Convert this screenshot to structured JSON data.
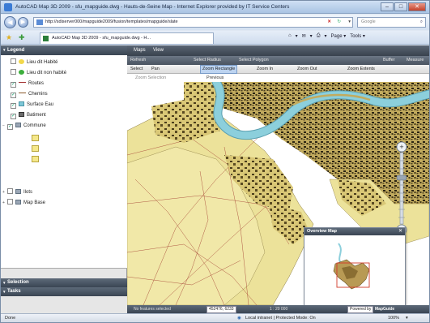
{
  "window": {
    "title": "AutoCAD Map 3D 2009 - sfu_mapguide.dwg - Hauts-de-Seine Map - Internet Explorer provided by IT Service Centers",
    "controls": {
      "minimize": "–",
      "maximize": "□",
      "close": "✕"
    }
  },
  "addressbar": {
    "url": "http://sdiserver000/mapguide2009/fusion/templates/mapguide/slate",
    "search_placeholder": "Google",
    "back": "◀",
    "forward": "▶",
    "stop": "✕",
    "refresh": "↻",
    "search_icon": "⌕"
  },
  "tabs": {
    "favorites_star": "★",
    "add_favorite": "✚",
    "active_tab": "AutoCAD Map 3D 2009 - sfu_mapguide.dwg - H...",
    "tools": [
      "⌂",
      "▾",
      "✉",
      "▾",
      "⎙",
      "▾",
      "Page ▾",
      "Tools ▾"
    ]
  },
  "legend": {
    "title": "Legend",
    "items": [
      {
        "label": "Lieu dit Habité",
        "swatch": "#f2d84b",
        "shape": "dot",
        "checked": false
      },
      {
        "label": "Lieu dit non habité",
        "swatch": "#3cae3c",
        "shape": "dot",
        "checked": false
      },
      {
        "label": "Routes",
        "swatch": "#a33333",
        "shape": "line",
        "checked": true
      },
      {
        "label": "Chemins",
        "swatch": "#8b5a2b",
        "shape": "line",
        "checked": true
      },
      {
        "label": "Surface Eau",
        "swatch": "#7fc8d8",
        "shape": "box",
        "checked": true
      },
      {
        "label": "Batiment",
        "swatch": "#6b6b6b",
        "shape": "box",
        "checked": true
      },
      {
        "label": "Commune",
        "swatch": "#f5e88a",
        "shape": "group",
        "checked": true
      },
      {
        "label": "Ilots",
        "swatch": "#9aa6b5",
        "shape": "group",
        "checked": false
      },
      {
        "label": "Map Base",
        "swatch": "#9aa6b5",
        "shape": "group",
        "checked": false
      }
    ],
    "expander": "+",
    "scroll_left": "◀",
    "scroll_right": "▶"
  },
  "panels": {
    "selection": "Selection",
    "tasks": "Tasks"
  },
  "map": {
    "menu": [
      "Maps",
      "View"
    ],
    "toolbar1": [
      "Refresh",
      "Select Radius",
      "Select Polygon",
      "Buffer",
      "Measure"
    ],
    "toolbar2": [
      "Select",
      "Pan",
      "Zoom Rectangle",
      "Zoom In",
      "Zoom Out",
      "Zoom Extents"
    ],
    "toolbar3": [
      "Zoom Selection",
      "Previous"
    ],
    "overview_title": "Overview Map",
    "overview_close": "✕",
    "status": {
      "selected": "No features selected",
      "coords": "452476, 6233",
      "scale": "1 : 20 000",
      "powered": "Powered by",
      "brand": "MapGuide"
    },
    "zoom_plus": "+",
    "zoom_minus": "−"
  },
  "statusbar": {
    "left": "Done",
    "zone": "Local intranet | Protected Mode: On",
    "zoom": "100%"
  },
  "colors": {
    "land": "#ece29a",
    "river": "#8ccfdc",
    "block": "#b9a35a",
    "build": "#3a3320"
  }
}
